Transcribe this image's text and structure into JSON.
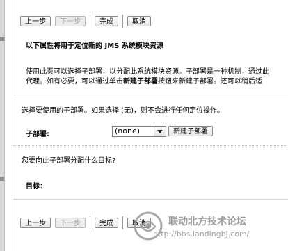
{
  "wizard": {
    "top_buttons": {
      "previous": "上一步",
      "next": "下一步",
      "finish": "完成",
      "cancel": "取消"
    },
    "bottom_buttons": {
      "previous": "上一步",
      "next": "下一步",
      "finish": "完成",
      "cancel": "取消"
    },
    "heading": "以下属性将用于定位新的 JMS 系统模块资源",
    "description_line1": "使用此页可以选择子部署，以分配此系统模块资源。子部署是一种机制，通过此",
    "description_line2_a": "代理。如有必要，可以通过单击",
    "description_line2_bold": "新建子部署",
    "description_line2_b": "按钮来新建子部署。还可以稍后适",
    "select_instruction": "选择要使用的子部署。如果选择 (无)，则不会进行任何定位操作。",
    "subdeployment_label": "子部署:",
    "subdeployment_value": "(none)",
    "new_subdeployment_button": "新建子部署",
    "targets_question": "您要向此子部署分配什么目标?",
    "targets_label": "目标："
  },
  "watermark": {
    "title": "联动北方技术论坛",
    "url": "http://bbs.landingbj.com/"
  }
}
